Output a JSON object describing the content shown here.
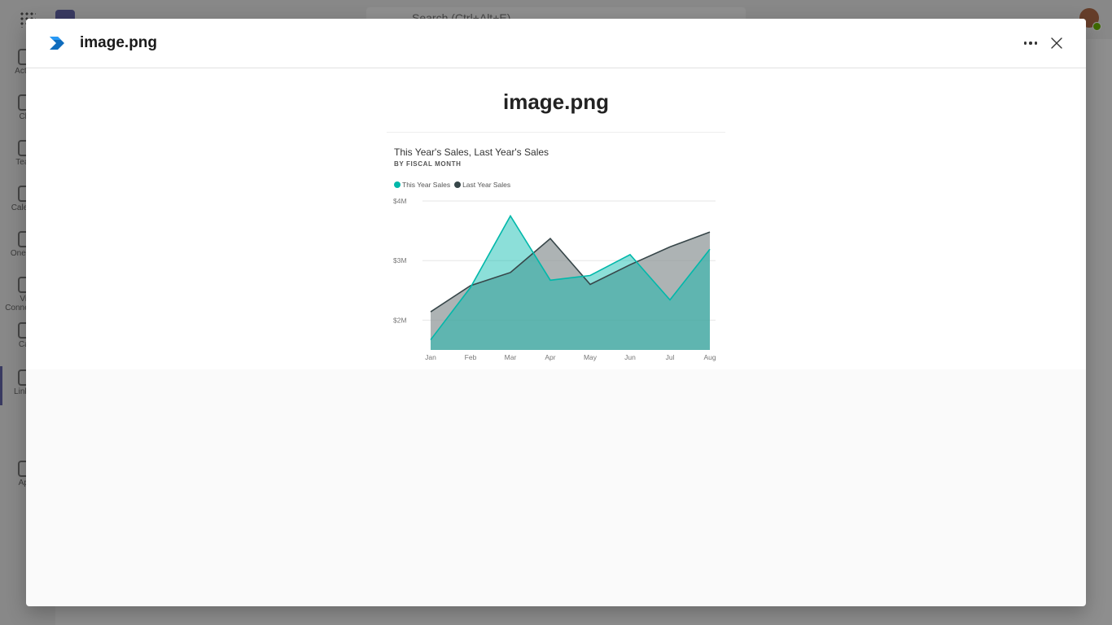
{
  "background": {
    "search_placeholder": "Search (Ctrl+Alt+E)",
    "rail_items": [
      {
        "label": "Activity",
        "icon": "bell-icon"
      },
      {
        "label": "Chat",
        "icon": "chat-icon"
      },
      {
        "label": "Teams",
        "icon": "teams-icon"
      },
      {
        "label": "Calendar",
        "icon": "calendar-icon"
      },
      {
        "label": "OneDrive",
        "icon": "cloud-icon"
      },
      {
        "label": "Viva Connections",
        "icon": "viva-icon"
      },
      {
        "label": "Calls",
        "icon": "location-icon"
      },
      {
        "label": "Link Up",
        "icon": "link-icon"
      },
      {
        "label": "Apps",
        "icon": "apps-icon"
      }
    ]
  },
  "modal": {
    "title": "image.png",
    "more_icon": "ellipsis-icon",
    "close_icon": "close-icon"
  },
  "preview": {
    "heading": "image.png"
  },
  "chart_data": {
    "type": "area",
    "title": "This Year's Sales, Last Year's Sales",
    "subtitle": "BY FISCAL MONTH",
    "categories": [
      "Jan",
      "Feb",
      "Mar",
      "Apr",
      "May",
      "Jun",
      "Jul",
      "Aug"
    ],
    "series": [
      {
        "name": "This Year Sales",
        "color": "#01b8aa",
        "values": [
          1.67,
          2.55,
          3.75,
          2.67,
          2.75,
          3.1,
          2.34,
          3.19
        ]
      },
      {
        "name": "Last Year Sales",
        "color": "#374649",
        "values": [
          2.14,
          2.58,
          2.8,
          3.37,
          2.6,
          2.93,
          3.23,
          3.48
        ]
      }
    ],
    "yticks": [
      "$2M",
      "$3M",
      "$4M"
    ],
    "ytick_values": [
      2,
      3,
      4
    ],
    "ylim": [
      1.5,
      4.0
    ],
    "legend_position": "top-left",
    "grid": true
  }
}
